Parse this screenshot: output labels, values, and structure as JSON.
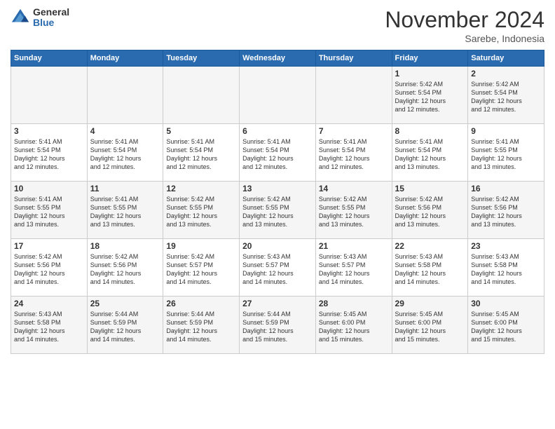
{
  "logo": {
    "general": "General",
    "blue": "Blue"
  },
  "title": "November 2024",
  "subtitle": "Sarebe, Indonesia",
  "days_header": [
    "Sunday",
    "Monday",
    "Tuesday",
    "Wednesday",
    "Thursday",
    "Friday",
    "Saturday"
  ],
  "weeks": [
    [
      {
        "day": "",
        "info": ""
      },
      {
        "day": "",
        "info": ""
      },
      {
        "day": "",
        "info": ""
      },
      {
        "day": "",
        "info": ""
      },
      {
        "day": "",
        "info": ""
      },
      {
        "day": "1",
        "info": "Sunrise: 5:42 AM\nSunset: 5:54 PM\nDaylight: 12 hours\nand 12 minutes."
      },
      {
        "day": "2",
        "info": "Sunrise: 5:42 AM\nSunset: 5:54 PM\nDaylight: 12 hours\nand 12 minutes."
      }
    ],
    [
      {
        "day": "3",
        "info": "Sunrise: 5:41 AM\nSunset: 5:54 PM\nDaylight: 12 hours\nand 12 minutes."
      },
      {
        "day": "4",
        "info": "Sunrise: 5:41 AM\nSunset: 5:54 PM\nDaylight: 12 hours\nand 12 minutes."
      },
      {
        "day": "5",
        "info": "Sunrise: 5:41 AM\nSunset: 5:54 PM\nDaylight: 12 hours\nand 12 minutes."
      },
      {
        "day": "6",
        "info": "Sunrise: 5:41 AM\nSunset: 5:54 PM\nDaylight: 12 hours\nand 12 minutes."
      },
      {
        "day": "7",
        "info": "Sunrise: 5:41 AM\nSunset: 5:54 PM\nDaylight: 12 hours\nand 12 minutes."
      },
      {
        "day": "8",
        "info": "Sunrise: 5:41 AM\nSunset: 5:54 PM\nDaylight: 12 hours\nand 13 minutes."
      },
      {
        "day": "9",
        "info": "Sunrise: 5:41 AM\nSunset: 5:55 PM\nDaylight: 12 hours\nand 13 minutes."
      }
    ],
    [
      {
        "day": "10",
        "info": "Sunrise: 5:41 AM\nSunset: 5:55 PM\nDaylight: 12 hours\nand 13 minutes."
      },
      {
        "day": "11",
        "info": "Sunrise: 5:41 AM\nSunset: 5:55 PM\nDaylight: 12 hours\nand 13 minutes."
      },
      {
        "day": "12",
        "info": "Sunrise: 5:42 AM\nSunset: 5:55 PM\nDaylight: 12 hours\nand 13 minutes."
      },
      {
        "day": "13",
        "info": "Sunrise: 5:42 AM\nSunset: 5:55 PM\nDaylight: 12 hours\nand 13 minutes."
      },
      {
        "day": "14",
        "info": "Sunrise: 5:42 AM\nSunset: 5:55 PM\nDaylight: 12 hours\nand 13 minutes."
      },
      {
        "day": "15",
        "info": "Sunrise: 5:42 AM\nSunset: 5:56 PM\nDaylight: 12 hours\nand 13 minutes."
      },
      {
        "day": "16",
        "info": "Sunrise: 5:42 AM\nSunset: 5:56 PM\nDaylight: 12 hours\nand 13 minutes."
      }
    ],
    [
      {
        "day": "17",
        "info": "Sunrise: 5:42 AM\nSunset: 5:56 PM\nDaylight: 12 hours\nand 14 minutes."
      },
      {
        "day": "18",
        "info": "Sunrise: 5:42 AM\nSunset: 5:56 PM\nDaylight: 12 hours\nand 14 minutes."
      },
      {
        "day": "19",
        "info": "Sunrise: 5:42 AM\nSunset: 5:57 PM\nDaylight: 12 hours\nand 14 minutes."
      },
      {
        "day": "20",
        "info": "Sunrise: 5:43 AM\nSunset: 5:57 PM\nDaylight: 12 hours\nand 14 minutes."
      },
      {
        "day": "21",
        "info": "Sunrise: 5:43 AM\nSunset: 5:57 PM\nDaylight: 12 hours\nand 14 minutes."
      },
      {
        "day": "22",
        "info": "Sunrise: 5:43 AM\nSunset: 5:58 PM\nDaylight: 12 hours\nand 14 minutes."
      },
      {
        "day": "23",
        "info": "Sunrise: 5:43 AM\nSunset: 5:58 PM\nDaylight: 12 hours\nand 14 minutes."
      }
    ],
    [
      {
        "day": "24",
        "info": "Sunrise: 5:43 AM\nSunset: 5:58 PM\nDaylight: 12 hours\nand 14 minutes."
      },
      {
        "day": "25",
        "info": "Sunrise: 5:44 AM\nSunset: 5:59 PM\nDaylight: 12 hours\nand 14 minutes."
      },
      {
        "day": "26",
        "info": "Sunrise: 5:44 AM\nSunset: 5:59 PM\nDaylight: 12 hours\nand 14 minutes."
      },
      {
        "day": "27",
        "info": "Sunrise: 5:44 AM\nSunset: 5:59 PM\nDaylight: 12 hours\nand 15 minutes."
      },
      {
        "day": "28",
        "info": "Sunrise: 5:45 AM\nSunset: 6:00 PM\nDaylight: 12 hours\nand 15 minutes."
      },
      {
        "day": "29",
        "info": "Sunrise: 5:45 AM\nSunset: 6:00 PM\nDaylight: 12 hours\nand 15 minutes."
      },
      {
        "day": "30",
        "info": "Sunrise: 5:45 AM\nSunset: 6:00 PM\nDaylight: 12 hours\nand 15 minutes."
      }
    ]
  ]
}
